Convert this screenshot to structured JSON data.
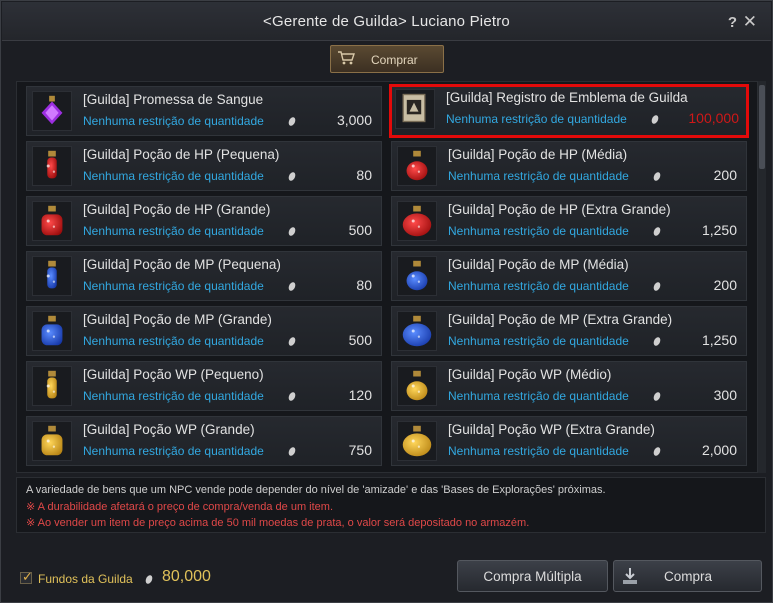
{
  "window": {
    "title": "<Gerente de Guilda> Luciano Pietro",
    "help": "?",
    "close": "✕"
  },
  "tabs": {
    "buy_label": "Comprar"
  },
  "items": [
    {
      "name": "[Guilda] Promessa de Sangue",
      "restriction": "Nenhuma restrição de quantidade",
      "price": "3,000",
      "icon": "blood-promise-icon",
      "selected": false
    },
    {
      "name": "[Guilda] Registro de Emblema de Guilda",
      "restriction": "Nenhuma restrição de quantidade",
      "price": "100,000",
      "icon": "emblem-scroll-icon",
      "selected": true
    },
    {
      "name": "[Guilda] Poção de HP (Pequena)",
      "restriction": "Nenhuma restrição de quantidade",
      "price": "80",
      "icon": "hp-potion-small-icon",
      "selected": false
    },
    {
      "name": "[Guilda] Poção de HP (Média)",
      "restriction": "Nenhuma restrição de quantidade",
      "price": "200",
      "icon": "hp-potion-medium-icon",
      "selected": false
    },
    {
      "name": "[Guilda] Poção de HP (Grande)",
      "restriction": "Nenhuma restrição de quantidade",
      "price": "500",
      "icon": "hp-potion-large-icon",
      "selected": false
    },
    {
      "name": "[Guilda] Poção de HP (Extra Grande)",
      "restriction": "Nenhuma restrição de quantidade",
      "price": "1,250",
      "icon": "hp-potion-xlarge-icon",
      "selected": false
    },
    {
      "name": "[Guilda] Poção de MP (Pequena)",
      "restriction": "Nenhuma restrição de quantidade",
      "price": "80",
      "icon": "mp-potion-small-icon",
      "selected": false
    },
    {
      "name": "[Guilda] Poção de MP (Média)",
      "restriction": "Nenhuma restrição de quantidade",
      "price": "200",
      "icon": "mp-potion-medium-icon",
      "selected": false
    },
    {
      "name": "[Guilda] Poção de MP (Grande)",
      "restriction": "Nenhuma restrição de quantidade",
      "price": "500",
      "icon": "mp-potion-large-icon",
      "selected": false
    },
    {
      "name": "[Guilda] Poção de MP (Extra Grande)",
      "restriction": "Nenhuma restrição de quantidade",
      "price": "1,250",
      "icon": "mp-potion-xlarge-icon",
      "selected": false
    },
    {
      "name": "[Guilda] Poção WP (Pequeno)",
      "restriction": "Nenhuma restrição de quantidade",
      "price": "120",
      "icon": "wp-potion-small-icon",
      "selected": false
    },
    {
      "name": "[Guilda] Poção WP (Médio)",
      "restriction": "Nenhuma restrição de quantidade",
      "price": "300",
      "icon": "wp-potion-medium-icon",
      "selected": false
    },
    {
      "name": "[Guilda] Poção WP (Grande)",
      "restriction": "Nenhuma restrição de quantidade",
      "price": "750",
      "icon": "wp-potion-large-icon",
      "selected": false
    },
    {
      "name": "[Guilda] Poção WP (Extra Grande)",
      "restriction": "Nenhuma restrição de quantidade",
      "price": "2,000",
      "icon": "wp-potion-xlarge-icon",
      "selected": false
    }
  ],
  "info": {
    "line1": "A variedade de bens que um NPC vende pode depender do nível de 'amizade' e das 'Bases de Explorações' próximas.",
    "line2": "※ A durabilidade afetará o preço de compra/venda de um item.",
    "line3": "※ Ao vender um item de preço acima de  50 mil moedas de prata, o valor será depositado no armazém."
  },
  "footer": {
    "funds_label": "Fundos da Guilda",
    "funds_amount": "80,000",
    "funds_checked": true,
    "multi_buy_label": "Compra Múltipla",
    "buy_label": "Compra"
  },
  "colors": {
    "restriction": "#32a8e0",
    "selected_border": "#e30a0a",
    "selected_price": "#d01818",
    "funds": "#e0c15a",
    "warning": "#e04848"
  }
}
